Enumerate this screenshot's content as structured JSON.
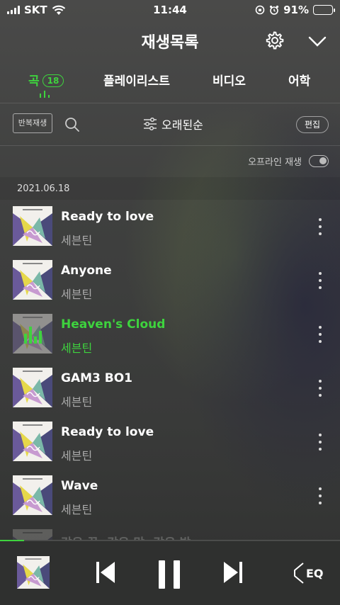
{
  "status": {
    "carrier": "SKT",
    "time": "11:44",
    "battery": "91%",
    "battery_level": 0.91
  },
  "header": {
    "title": "재생목록"
  },
  "tabs": [
    {
      "label": "곡",
      "badge": "18"
    },
    {
      "label": "플레이리스트"
    },
    {
      "label": "비디오"
    },
    {
      "label": "어학"
    }
  ],
  "toolbar": {
    "repeat_label": "반복재생",
    "sort_label": "오래된순",
    "edit_label": "편집"
  },
  "offline": {
    "label": "오프라인 재생"
  },
  "date": "2021.06.18",
  "songs": [
    {
      "title": "Ready to love",
      "artist": "세븐틴"
    },
    {
      "title": "Anyone",
      "artist": "세븐틴"
    },
    {
      "title": "Heaven's Cloud",
      "artist": "세븐틴"
    },
    {
      "title": "GAM3 BO1",
      "artist": "세븐틴"
    },
    {
      "title": "Ready to love",
      "artist": "세븐틴"
    },
    {
      "title": "Wave",
      "artist": "세븐틴"
    },
    {
      "title": "같은 꿈, 같은 맘, 같은 밤",
      "artist": ""
    }
  ],
  "player": {
    "eq_label": "EQ",
    "progress": 0.07
  },
  "colors": {
    "accent": "#3ed33e"
  }
}
